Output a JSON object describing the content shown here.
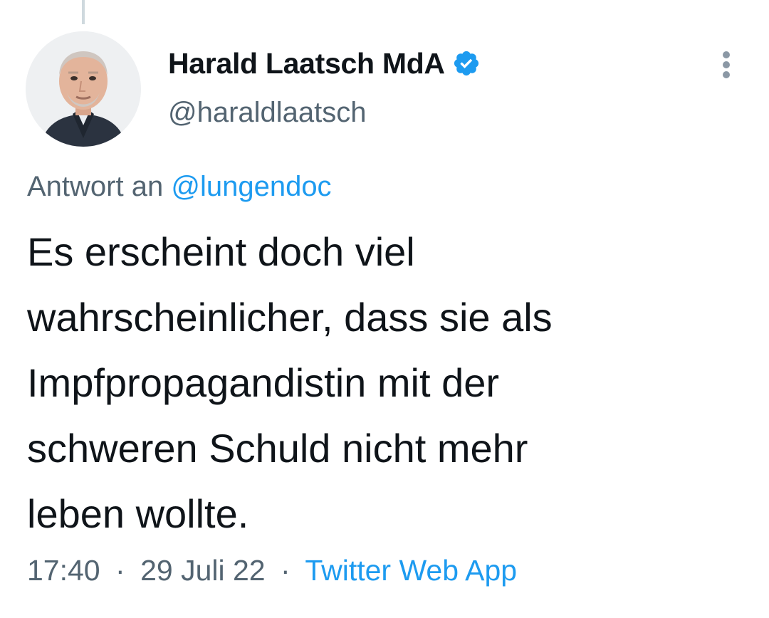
{
  "tweet": {
    "author": {
      "display_name": "Harald Laatsch MdA",
      "handle": "@haraldlaatsch",
      "verified": true,
      "avatar_icon": "person-avatar"
    },
    "reply": {
      "prefix": "Antwort an",
      "mention": "@lungendoc"
    },
    "text_lines": [
      "Es erscheint doch viel",
      "wahrscheinlicher, dass sie als",
      "Impfpropagandistin mit der",
      "schweren Schuld nicht mehr",
      "leben wollte."
    ],
    "meta": {
      "time": "17:40",
      "date": "29 Juli 22",
      "separator": "·",
      "source": "Twitter Web App"
    }
  },
  "icons": {
    "verified": "verified-badge-icon",
    "more": "more-options-icon"
  },
  "colors": {
    "accent": "#1d9bf0",
    "text_primary": "#0f1419",
    "text_secondary": "#536471",
    "thread_line": "#cfd9de"
  }
}
